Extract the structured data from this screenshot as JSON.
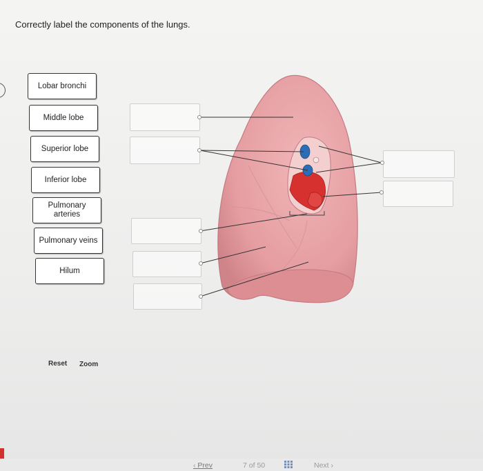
{
  "question": {
    "text": "Correctly label the components of the lungs."
  },
  "labels": [
    {
      "id": "lobar-bronchi",
      "text": "Lobar bronchi"
    },
    {
      "id": "middle-lobe",
      "text": "Middle lobe"
    },
    {
      "id": "superior-lobe",
      "text": "Superior lobe"
    },
    {
      "id": "inferior-lobe",
      "text": "Inferior lobe"
    },
    {
      "id": "pulmonary-arteries",
      "text": "Pulmonary arteries"
    },
    {
      "id": "pulmonary-veins",
      "text": "Pulmonary veins"
    },
    {
      "id": "hilum",
      "text": "Hilum"
    }
  ],
  "controls": {
    "reset": "Reset",
    "zoom": "Zoom"
  },
  "footer": {
    "prev": "Prev",
    "prev_icon": "chevron-left-icon",
    "page_current": "7",
    "page_of": "of",
    "page_total": "50",
    "grid_icon": "grid-icon",
    "next": "Next",
    "next_icon": "chevron-right-icon"
  },
  "colors": {
    "lung": "#e9a3a6",
    "lung_dark": "#c97b80",
    "artery": "#2d6db5",
    "vein": "#d6312f",
    "accent": "#d0312d"
  }
}
